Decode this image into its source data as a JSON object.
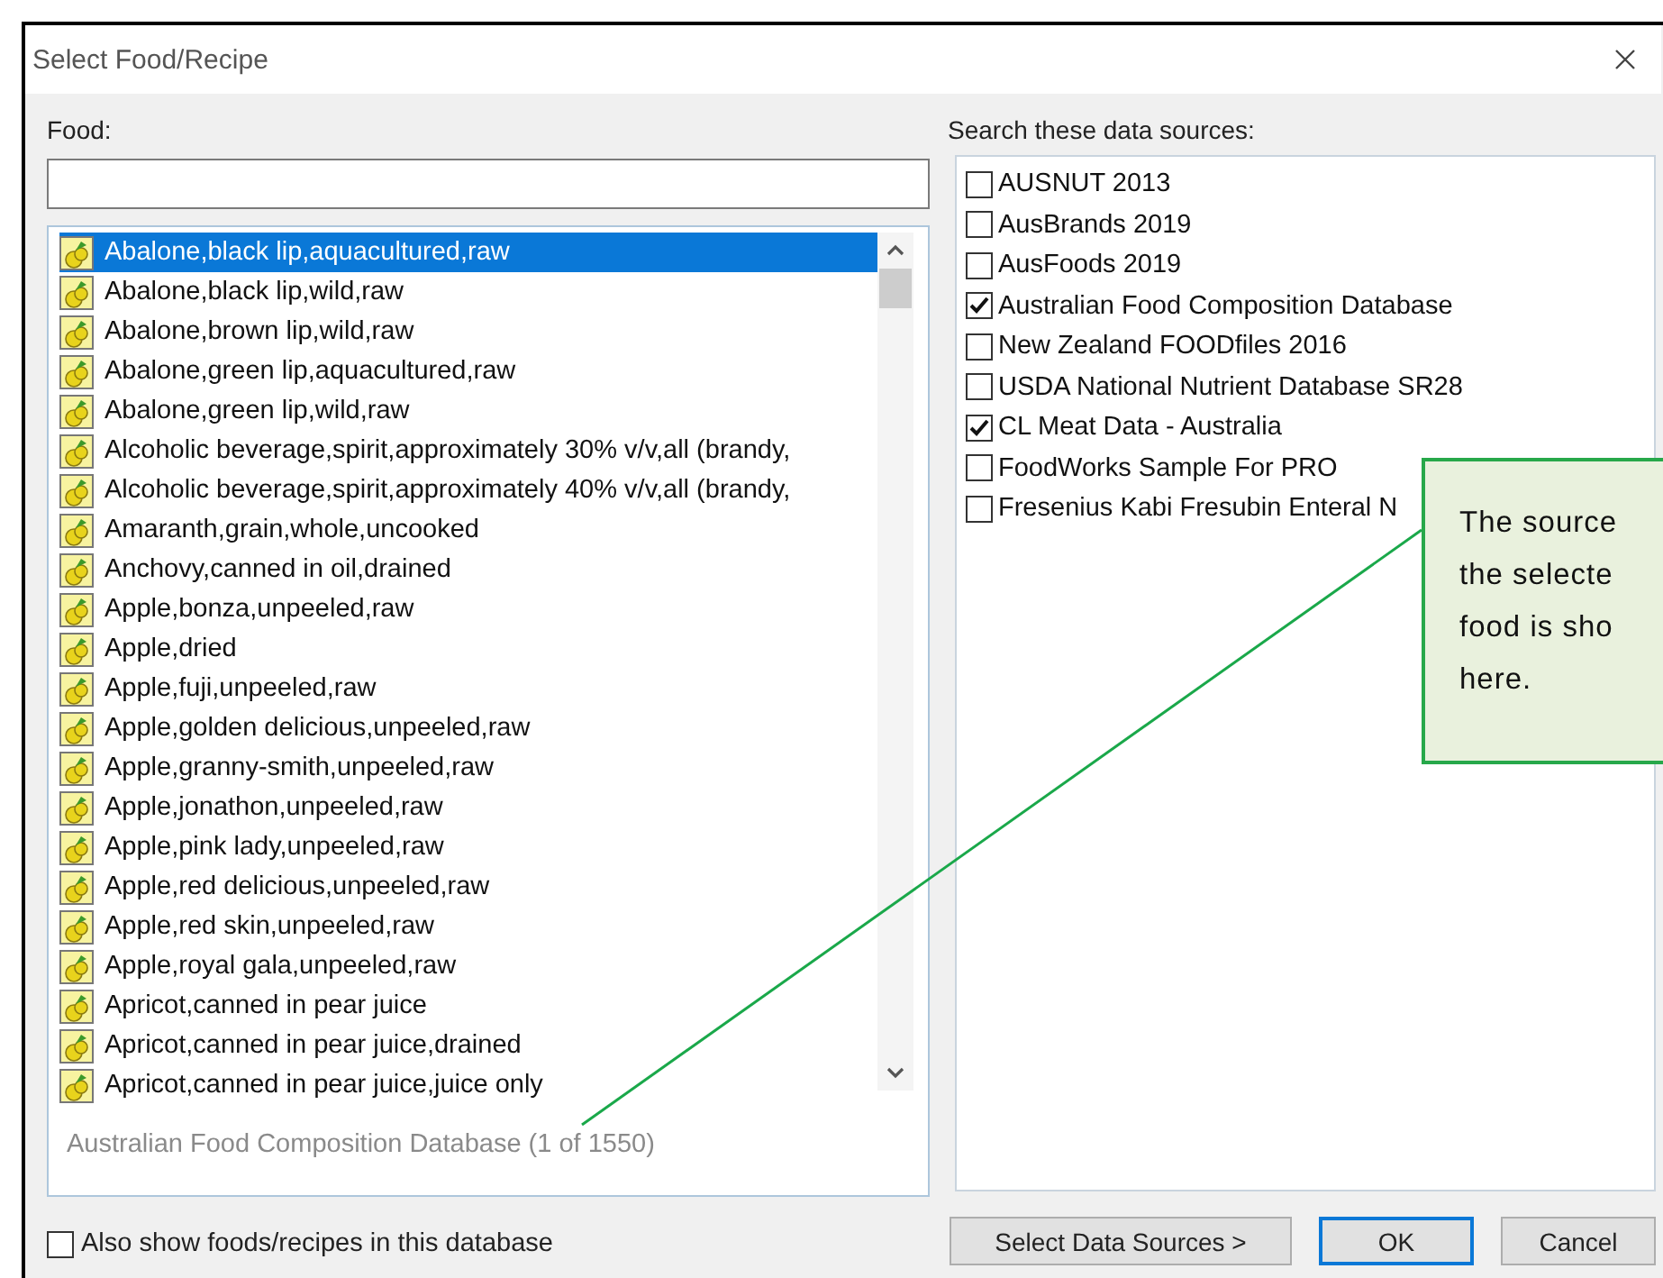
{
  "window": {
    "title": "Select Food/Recipe"
  },
  "food_panel": {
    "label": "Food:"
  },
  "food_list": {
    "items": [
      {
        "name": "Abalone,black lip,aquacultured,raw",
        "selected": true
      },
      {
        "name": "Abalone,black lip,wild,raw",
        "selected": false
      },
      {
        "name": "Abalone,brown lip,wild,raw",
        "selected": false
      },
      {
        "name": "Abalone,green lip,aquacultured,raw",
        "selected": false
      },
      {
        "name": "Abalone,green lip,wild,raw",
        "selected": false
      },
      {
        "name": "Alcoholic beverage,spirit,approximately 30% v/v,all (brandy,",
        "selected": false
      },
      {
        "name": "Alcoholic beverage,spirit,approximately 40% v/v,all (brandy,",
        "selected": false
      },
      {
        "name": "Amaranth,grain,whole,uncooked",
        "selected": false
      },
      {
        "name": "Anchovy,canned in oil,drained",
        "selected": false
      },
      {
        "name": "Apple,bonza,unpeeled,raw",
        "selected": false
      },
      {
        "name": "Apple,dried",
        "selected": false
      },
      {
        "name": "Apple,fuji,unpeeled,raw",
        "selected": false
      },
      {
        "name": "Apple,golden delicious,unpeeled,raw",
        "selected": false
      },
      {
        "name": "Apple,granny-smith,unpeeled,raw",
        "selected": false
      },
      {
        "name": "Apple,jonathon,unpeeled,raw",
        "selected": false
      },
      {
        "name": "Apple,pink lady,unpeeled,raw",
        "selected": false
      },
      {
        "name": "Apple,red delicious,unpeeled,raw",
        "selected": false
      },
      {
        "name": "Apple,red skin,unpeeled,raw",
        "selected": false
      },
      {
        "name": "Apple,royal gala,unpeeled,raw",
        "selected": false
      },
      {
        "name": "Apricot,canned in pear juice",
        "selected": false
      },
      {
        "name": "Apricot,canned in pear juice,drained",
        "selected": false
      },
      {
        "name": "Apricot,canned in pear juice,juice only",
        "selected": false
      }
    ],
    "status": "Australian Food Composition Database (1 of 1550)"
  },
  "also_show": {
    "label": "Also show foods/recipes in this database",
    "checked": false
  },
  "data_sources": {
    "label": "Search these data sources:",
    "items": [
      {
        "name": "AUSNUT 2013",
        "checked": false
      },
      {
        "name": "AusBrands 2019",
        "checked": false
      },
      {
        "name": "AusFoods 2019",
        "checked": false
      },
      {
        "name": "Australian Food Composition Database",
        "checked": true
      },
      {
        "name": "New Zealand FOODfiles 2016",
        "checked": false
      },
      {
        "name": "USDA National Nutrient Database SR28",
        "checked": false
      },
      {
        "name": "CL Meat Data - Australia",
        "checked": true
      },
      {
        "name": "FoodWorks Sample For PRO",
        "checked": false
      },
      {
        "name": "Fresenius Kabi Fresubin Enteral N",
        "checked": false
      }
    ]
  },
  "buttons": [
    {
      "label": "Select Data Sources >",
      "default": false
    },
    {
      "label": "OK",
      "default": true
    },
    {
      "label": "Cancel",
      "default": false
    }
  ],
  "callout": {
    "lines": [
      "The source",
      "the selecte",
      "food is sho",
      "here."
    ]
  }
}
